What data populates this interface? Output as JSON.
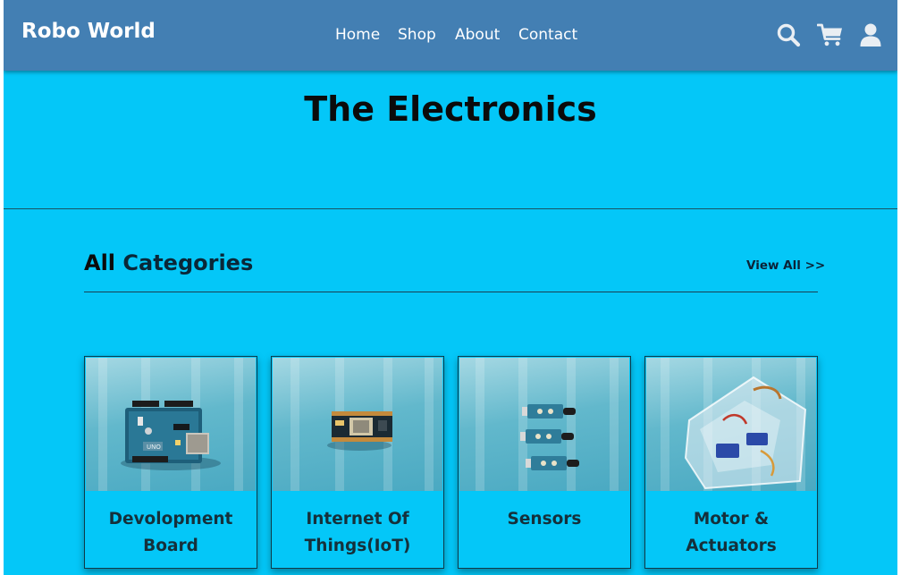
{
  "navbar": {
    "brand": "Robo World",
    "links": [
      {
        "label": "Home"
      },
      {
        "label": "Shop"
      },
      {
        "label": "About"
      },
      {
        "label": "Contact"
      }
    ],
    "icons": [
      "search-icon",
      "cart-icon",
      "user-icon"
    ]
  },
  "hero": {
    "title": "The Electronics"
  },
  "categories": {
    "title_accent": "All",
    "title_rest": "Categories",
    "view_all": "View All >>",
    "items": [
      {
        "label": "Devolopment Board",
        "image": "arduino-board-image"
      },
      {
        "label": "Internet Of Things(IoT)",
        "image": "nodemcu-board-image"
      },
      {
        "label": "Sensors",
        "image": "sensor-modules-image"
      },
      {
        "label": "Motor & Actuators",
        "image": "servo-motors-image"
      }
    ]
  },
  "colors": {
    "navbar": "#437fb3",
    "background": "#04c7f8",
    "text": "#0b0b0b"
  }
}
